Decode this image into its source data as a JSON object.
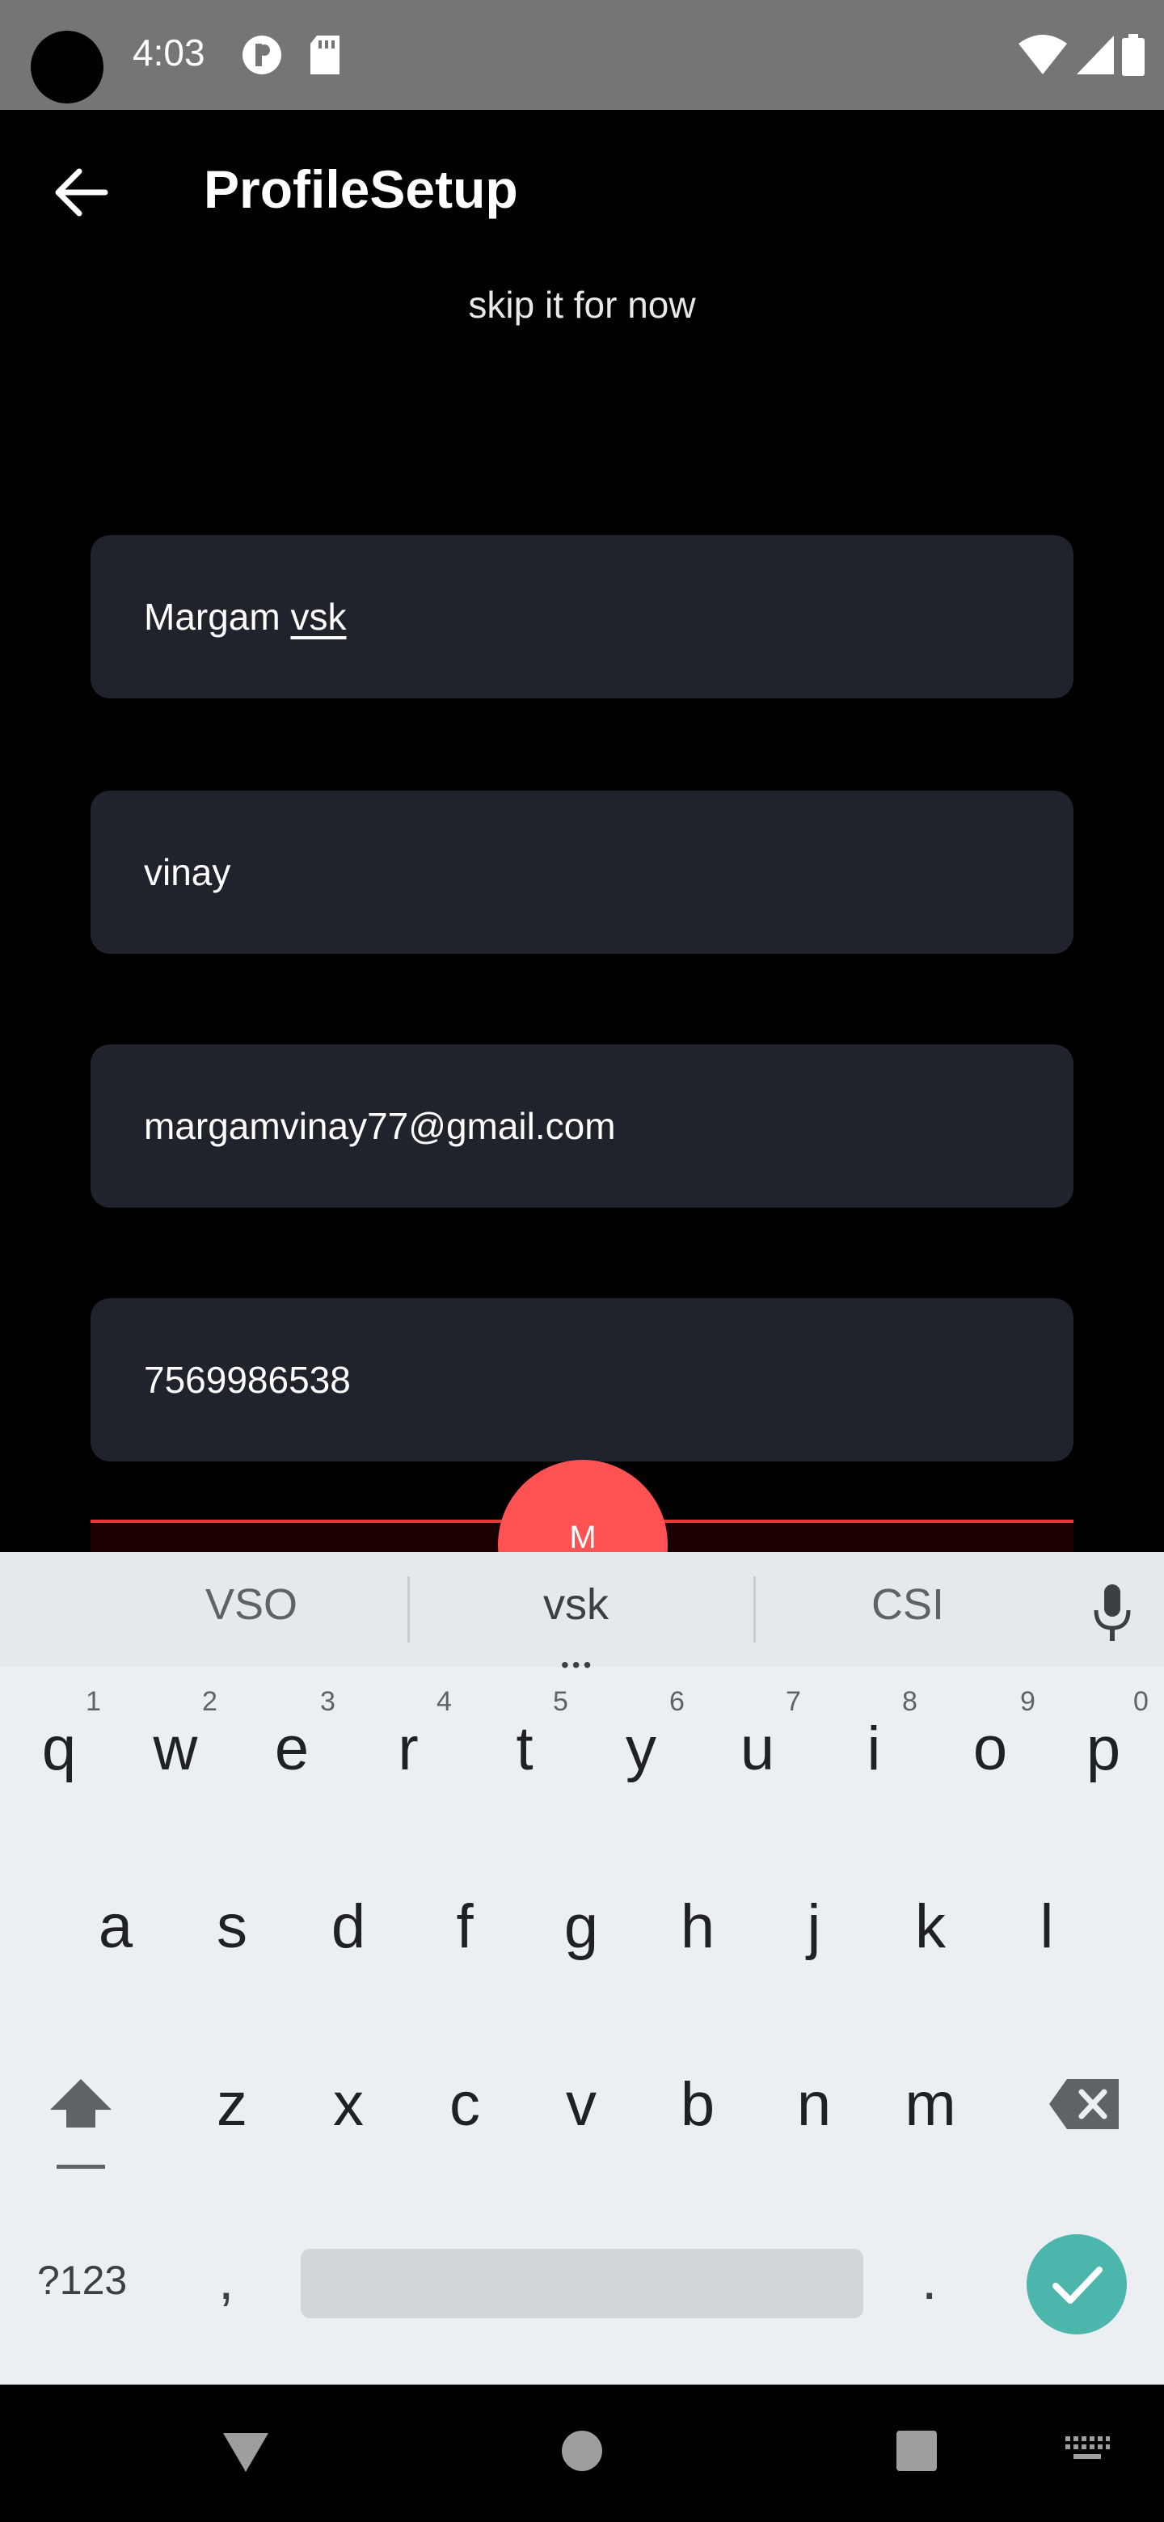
{
  "status_bar": {
    "time": "4:03"
  },
  "app_bar": {
    "title": "ProfileSetup"
  },
  "skip_text": "skip it for now",
  "fields": {
    "last_name_part1": "Margam ",
    "last_name_part2": "vsk",
    "first_name": "vinay",
    "email": "margamvinay77@gmail.com",
    "phone": "7569986538"
  },
  "fab": {
    "label": "M"
  },
  "keyboard": {
    "suggestions": [
      "VSO",
      "vsk",
      "CSI"
    ],
    "row1": [
      "q",
      "w",
      "e",
      "r",
      "t",
      "y",
      "u",
      "i",
      "o",
      "p"
    ],
    "row1_numbers": [
      "1",
      "2",
      "3",
      "4",
      "5",
      "6",
      "7",
      "8",
      "9",
      "0"
    ],
    "row2": [
      "a",
      "s",
      "d",
      "f",
      "g",
      "h",
      "j",
      "k",
      "l"
    ],
    "row3": [
      "z",
      "x",
      "c",
      "v",
      "b",
      "n",
      "m"
    ],
    "symbols_label": "?123",
    "comma": ",",
    "period": "."
  },
  "colors": {
    "field_bg": "#20222c",
    "fab": "#ff5252",
    "enter": "#4db6ac",
    "accent_line": "#e53935"
  }
}
